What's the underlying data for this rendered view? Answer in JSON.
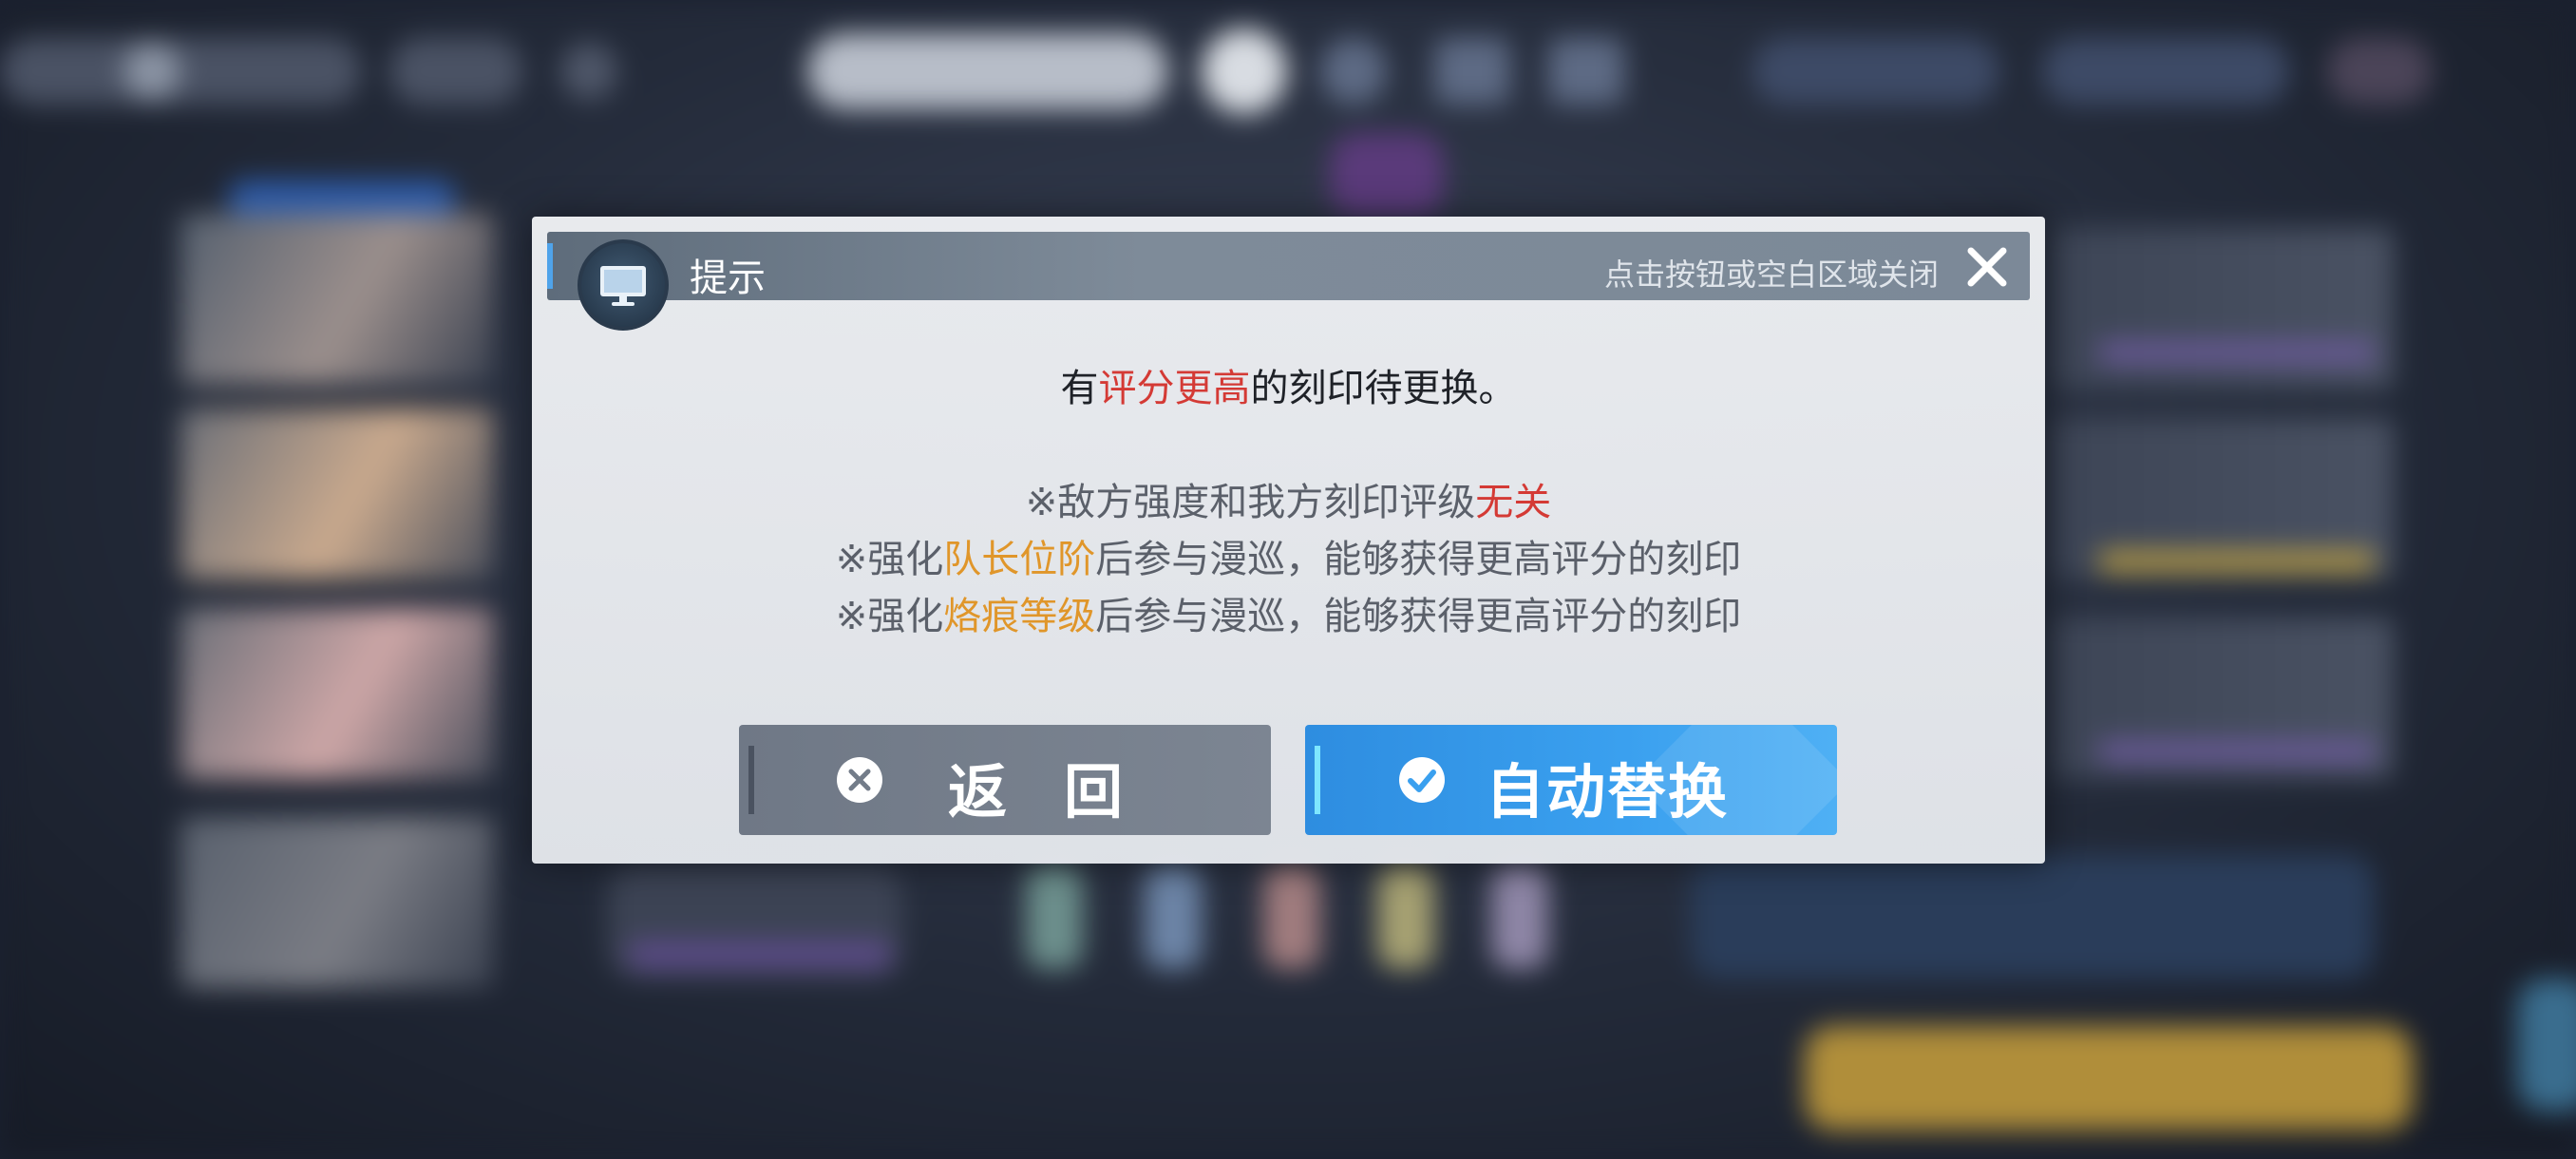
{
  "dialog": {
    "title": "提示",
    "close_hint": "点击按钮或空白区域关闭",
    "header_icon": "monitor-icon",
    "message_main": {
      "prefix": "有",
      "highlight": "评分更高",
      "suffix": "的刻印待更换。"
    },
    "notes": [
      {
        "prefix": "※敌方强度和我方刻印评级",
        "highlight": "无关",
        "suffix": ""
      },
      {
        "prefix": "※强化",
        "highlight": "队长位阶",
        "suffix": "后参与漫巡，能够获得更高评分的刻印"
      },
      {
        "prefix": "※强化",
        "highlight": "烙痕等级",
        "suffix": "后参与漫巡，能够获得更高评分的刻印"
      }
    ],
    "buttons": {
      "back_label": "返回",
      "auto_label": "自动替换"
    }
  },
  "colors": {
    "highlight_red": "#d43a35",
    "highlight_orange": "#e0962a",
    "primary_button": "#3aa0ef",
    "secondary_button": "#737c89"
  }
}
